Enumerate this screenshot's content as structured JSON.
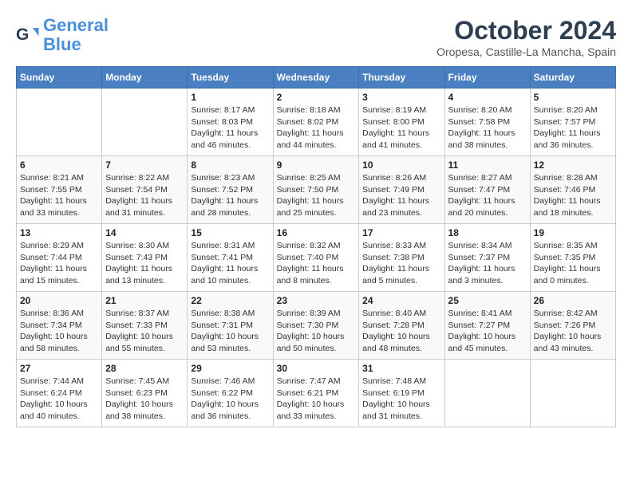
{
  "header": {
    "logo_line1": "General",
    "logo_line2": "Blue",
    "month": "October 2024",
    "location": "Oropesa, Castille-La Mancha, Spain"
  },
  "weekdays": [
    "Sunday",
    "Monday",
    "Tuesday",
    "Wednesday",
    "Thursday",
    "Friday",
    "Saturday"
  ],
  "weeks": [
    [
      {
        "day": "",
        "info": ""
      },
      {
        "day": "",
        "info": ""
      },
      {
        "day": "1",
        "info": "Sunrise: 8:17 AM\nSunset: 8:03 PM\nDaylight: 11 hours and 46 minutes."
      },
      {
        "day": "2",
        "info": "Sunrise: 8:18 AM\nSunset: 8:02 PM\nDaylight: 11 hours and 44 minutes."
      },
      {
        "day": "3",
        "info": "Sunrise: 8:19 AM\nSunset: 8:00 PM\nDaylight: 11 hours and 41 minutes."
      },
      {
        "day": "4",
        "info": "Sunrise: 8:20 AM\nSunset: 7:58 PM\nDaylight: 11 hours and 38 minutes."
      },
      {
        "day": "5",
        "info": "Sunrise: 8:20 AM\nSunset: 7:57 PM\nDaylight: 11 hours and 36 minutes."
      }
    ],
    [
      {
        "day": "6",
        "info": "Sunrise: 8:21 AM\nSunset: 7:55 PM\nDaylight: 11 hours and 33 minutes."
      },
      {
        "day": "7",
        "info": "Sunrise: 8:22 AM\nSunset: 7:54 PM\nDaylight: 11 hours and 31 minutes."
      },
      {
        "day": "8",
        "info": "Sunrise: 8:23 AM\nSunset: 7:52 PM\nDaylight: 11 hours and 28 minutes."
      },
      {
        "day": "9",
        "info": "Sunrise: 8:25 AM\nSunset: 7:50 PM\nDaylight: 11 hours and 25 minutes."
      },
      {
        "day": "10",
        "info": "Sunrise: 8:26 AM\nSunset: 7:49 PM\nDaylight: 11 hours and 23 minutes."
      },
      {
        "day": "11",
        "info": "Sunrise: 8:27 AM\nSunset: 7:47 PM\nDaylight: 11 hours and 20 minutes."
      },
      {
        "day": "12",
        "info": "Sunrise: 8:28 AM\nSunset: 7:46 PM\nDaylight: 11 hours and 18 minutes."
      }
    ],
    [
      {
        "day": "13",
        "info": "Sunrise: 8:29 AM\nSunset: 7:44 PM\nDaylight: 11 hours and 15 minutes."
      },
      {
        "day": "14",
        "info": "Sunrise: 8:30 AM\nSunset: 7:43 PM\nDaylight: 11 hours and 13 minutes."
      },
      {
        "day": "15",
        "info": "Sunrise: 8:31 AM\nSunset: 7:41 PM\nDaylight: 11 hours and 10 minutes."
      },
      {
        "day": "16",
        "info": "Sunrise: 8:32 AM\nSunset: 7:40 PM\nDaylight: 11 hours and 8 minutes."
      },
      {
        "day": "17",
        "info": "Sunrise: 8:33 AM\nSunset: 7:38 PM\nDaylight: 11 hours and 5 minutes."
      },
      {
        "day": "18",
        "info": "Sunrise: 8:34 AM\nSunset: 7:37 PM\nDaylight: 11 hours and 3 minutes."
      },
      {
        "day": "19",
        "info": "Sunrise: 8:35 AM\nSunset: 7:35 PM\nDaylight: 11 hours and 0 minutes."
      }
    ],
    [
      {
        "day": "20",
        "info": "Sunrise: 8:36 AM\nSunset: 7:34 PM\nDaylight: 10 hours and 58 minutes."
      },
      {
        "day": "21",
        "info": "Sunrise: 8:37 AM\nSunset: 7:33 PM\nDaylight: 10 hours and 55 minutes."
      },
      {
        "day": "22",
        "info": "Sunrise: 8:38 AM\nSunset: 7:31 PM\nDaylight: 10 hours and 53 minutes."
      },
      {
        "day": "23",
        "info": "Sunrise: 8:39 AM\nSunset: 7:30 PM\nDaylight: 10 hours and 50 minutes."
      },
      {
        "day": "24",
        "info": "Sunrise: 8:40 AM\nSunset: 7:28 PM\nDaylight: 10 hours and 48 minutes."
      },
      {
        "day": "25",
        "info": "Sunrise: 8:41 AM\nSunset: 7:27 PM\nDaylight: 10 hours and 45 minutes."
      },
      {
        "day": "26",
        "info": "Sunrise: 8:42 AM\nSunset: 7:26 PM\nDaylight: 10 hours and 43 minutes."
      }
    ],
    [
      {
        "day": "27",
        "info": "Sunrise: 7:44 AM\nSunset: 6:24 PM\nDaylight: 10 hours and 40 minutes."
      },
      {
        "day": "28",
        "info": "Sunrise: 7:45 AM\nSunset: 6:23 PM\nDaylight: 10 hours and 38 minutes."
      },
      {
        "day": "29",
        "info": "Sunrise: 7:46 AM\nSunset: 6:22 PM\nDaylight: 10 hours and 36 minutes."
      },
      {
        "day": "30",
        "info": "Sunrise: 7:47 AM\nSunset: 6:21 PM\nDaylight: 10 hours and 33 minutes."
      },
      {
        "day": "31",
        "info": "Sunrise: 7:48 AM\nSunset: 6:19 PM\nDaylight: 10 hours and 31 minutes."
      },
      {
        "day": "",
        "info": ""
      },
      {
        "day": "",
        "info": ""
      }
    ]
  ]
}
